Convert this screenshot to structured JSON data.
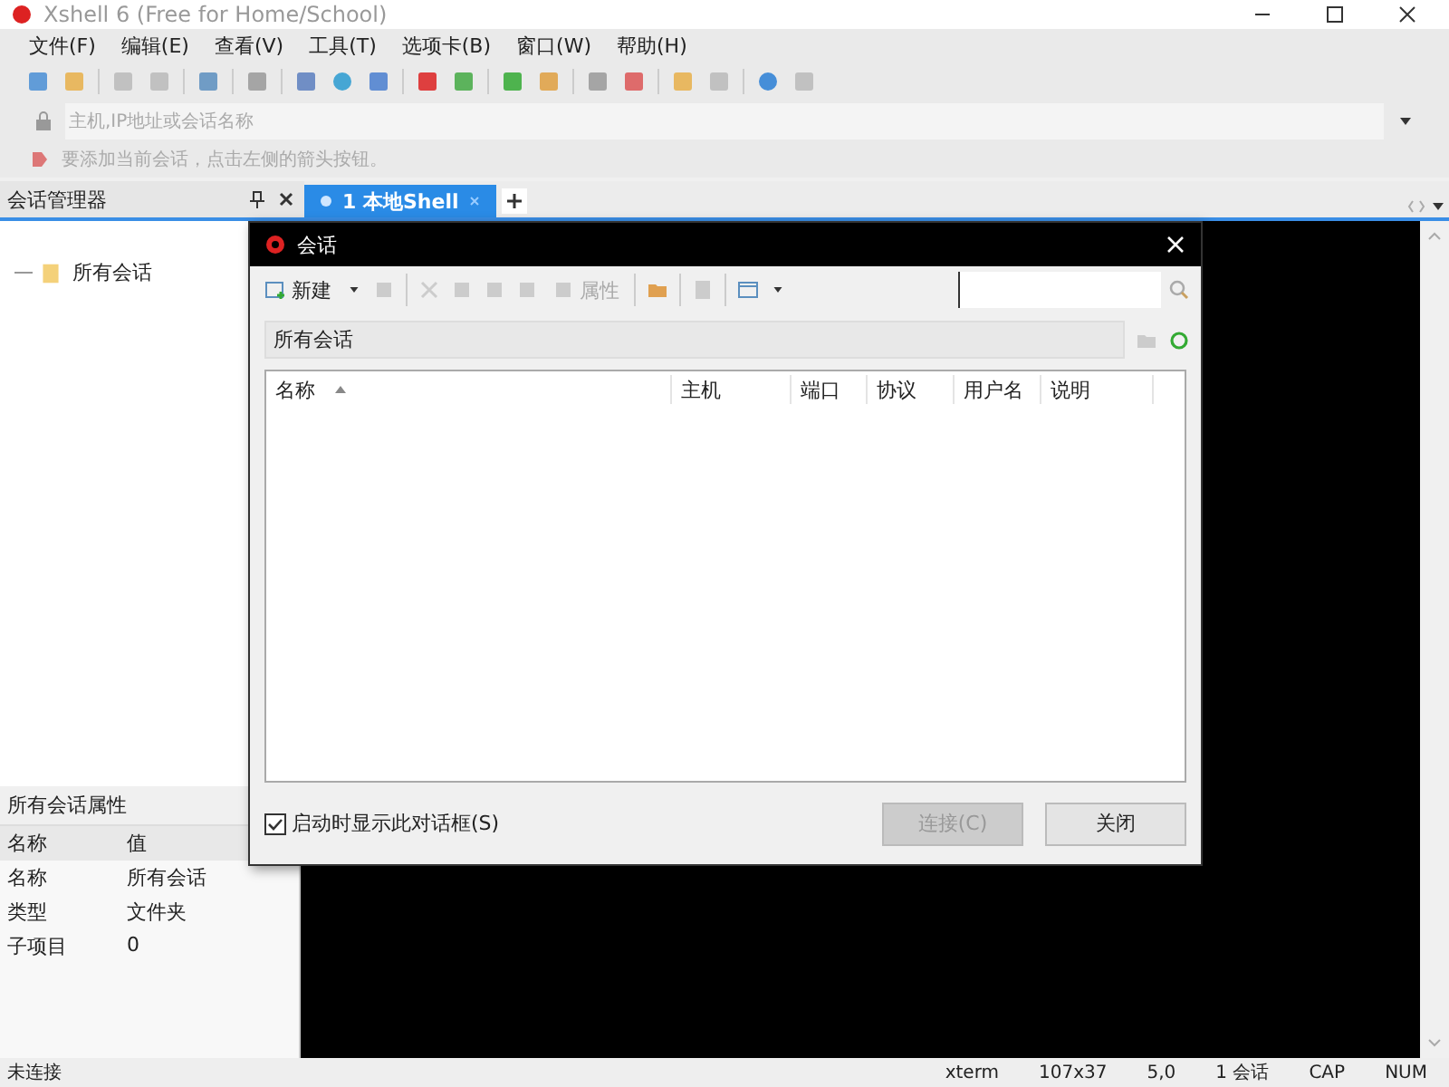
{
  "window": {
    "title": "Xshell 6 (Free for Home/School)"
  },
  "menu": [
    "文件(F)",
    "编辑(E)",
    "查看(V)",
    "工具(T)",
    "选项卡(B)",
    "窗口(W)",
    "帮助(H)"
  ],
  "address_bar": {
    "placeholder": "主机,IP地址或会话名称"
  },
  "hint_bar": {
    "text": "要添加当前会话，点击左侧的箭头按钮。"
  },
  "session_manager": {
    "title": "会话管理器",
    "tree": [
      {
        "label": "所有会话"
      }
    ]
  },
  "properties": {
    "title": "所有会话属性",
    "columns": [
      "名称",
      "值"
    ],
    "rows": [
      [
        "名称",
        "所有会话"
      ],
      [
        "类型",
        "文件夹"
      ],
      [
        "子项目",
        "0"
      ]
    ]
  },
  "tabs": [
    {
      "label": "1 本地Shell",
      "selected": true
    }
  ],
  "dialog": {
    "title": "会话",
    "new_label": "新建",
    "properties_label": "属性",
    "path": "所有会话",
    "columns": [
      "名称",
      "主机",
      "端口",
      "协议",
      "用户名",
      "说明"
    ],
    "show_on_startup": {
      "label": "启动时显示此对话框(S)",
      "checked": true
    },
    "buttons": [
      {
        "label": "连接(C)",
        "disabled": true
      },
      {
        "label": "关闭",
        "disabled": false
      }
    ]
  },
  "status_bar": [
    "未连接",
    "xterm",
    "107x37",
    "5,0",
    "1 会话",
    "CAP",
    "NUM"
  ]
}
